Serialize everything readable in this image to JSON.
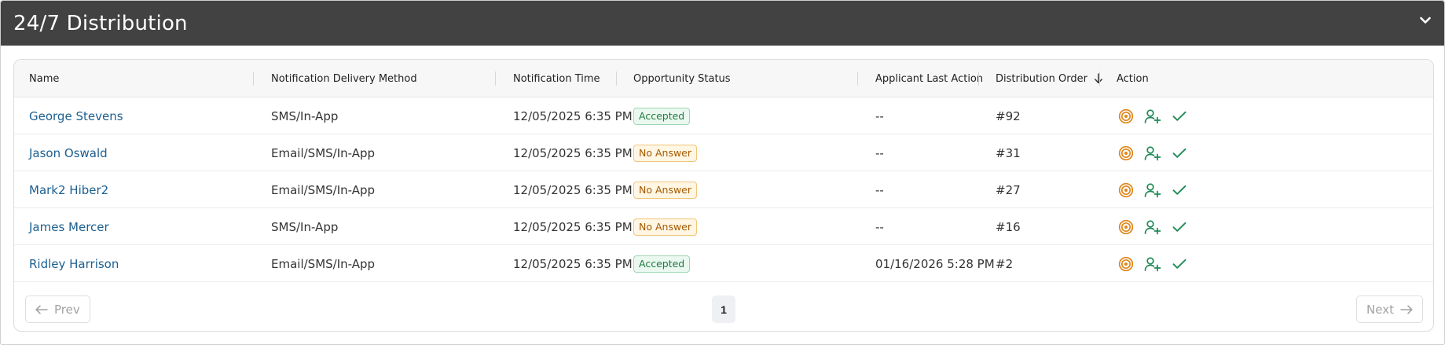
{
  "header": {
    "title": "24/7 Distribution",
    "collapse_icon": "chevron-down-icon"
  },
  "table": {
    "columns": [
      "Name",
      "Notification Delivery Method",
      "Notification Time",
      "Opportunity Status",
      "Applicant Last Action",
      "Distribution Order",
      "Action"
    ],
    "sort_icon": "arrow-down-icon",
    "rows": [
      {
        "name": "George Stevens",
        "method": "SMS/In-App",
        "time": "12/05/2025 6:35 PM",
        "status": "Accepted",
        "last_action": "--",
        "order": "#92"
      },
      {
        "name": "Jason Oswald",
        "method": "Email/SMS/In-App",
        "time": "12/05/2025 6:35 PM",
        "status": "No Answer",
        "last_action": "--",
        "order": "#31"
      },
      {
        "name": "Mark2 Hiber2",
        "method": "Email/SMS/In-App",
        "time": "12/05/2025 6:35 PM",
        "status": "No Answer",
        "last_action": "--",
        "order": "#27"
      },
      {
        "name": "James Mercer",
        "method": "SMS/In-App",
        "time": "12/05/2025 6:35 PM",
        "status": "No Answer",
        "last_action": "--",
        "order": "#16"
      },
      {
        "name": "Ridley Harrison",
        "method": "Email/SMS/In-App",
        "time": "12/05/2025 6:35 PM",
        "status": "Accepted",
        "last_action": "01/16/2026 5:28 PM",
        "order": "#2"
      }
    ]
  },
  "pagination": {
    "prev_label": "Prev",
    "next_label": "Next",
    "current_page": "1"
  },
  "colors": {
    "header_bg": "#424242",
    "link": "#1c5f91",
    "target_icon": "#e0861a",
    "action_green": "#1f8a55",
    "accepted": "#217a43",
    "no_answer": "#a55a00"
  }
}
